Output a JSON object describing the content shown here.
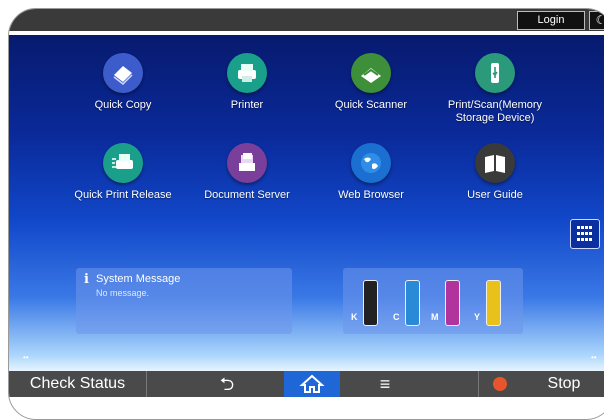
{
  "topbar": {
    "login_label": "Login",
    "moon_glyph": "☾"
  },
  "apps": [
    {
      "label": "Quick Copy",
      "icon": "copy-icon",
      "color": "#3c5ccc"
    },
    {
      "label": "Printer",
      "icon": "printer-icon",
      "color": "#1aa08a"
    },
    {
      "label": "Quick Scanner",
      "icon": "scanner-icon",
      "color": "#3d8f3a"
    },
    {
      "label": "Print/Scan(Memory Storage Device)",
      "icon": "usb-icon",
      "color": "#2a9a7a"
    },
    {
      "label": "Quick Print Release",
      "icon": "print-release-icon",
      "color": "#1aa08a"
    },
    {
      "label": "Document Server",
      "icon": "document-server-icon",
      "color": "#7a3f9a"
    },
    {
      "label": "Web Browser",
      "icon": "globe-icon",
      "color": "#1a6fd0"
    },
    {
      "label": "User Guide",
      "icon": "book-icon",
      "color": "#3a3a3a"
    }
  ],
  "system_message": {
    "icon_glyph": "i",
    "title": "System Message",
    "body": "No message."
  },
  "toner": [
    {
      "label": "K",
      "color": "#222222"
    },
    {
      "label": "C",
      "color": "#2a8ad8"
    },
    {
      "label": "M",
      "color": "#b0339e"
    },
    {
      "label": "Y",
      "color": "#e8c21a"
    }
  ],
  "page_dots": "••",
  "bottombar": {
    "check_status": "Check Status",
    "back_glyph": "⮌",
    "menu_glyph": "≡",
    "stop_label": "Stop"
  }
}
